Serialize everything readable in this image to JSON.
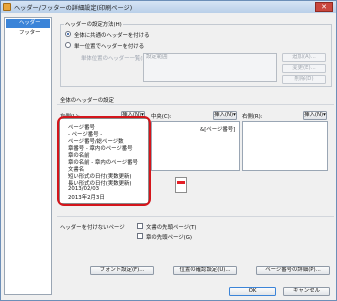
{
  "window": {
    "title": "ヘッダー/フッターの詳細設定(印刷ページ)",
    "close_glyph": "✕"
  },
  "nav": {
    "items": [
      {
        "label": "ヘッダー",
        "selected": true
      },
      {
        "label": "フッター",
        "selected": false
      }
    ]
  },
  "settings_group": {
    "title": "ヘッダーの設定方法(H)",
    "option_common": "全体に共通のヘッダーを付ける",
    "option_per_unit": "単一位置でヘッダーを付ける",
    "unit_list_label": "単体位置のヘッダー一覧(I):",
    "unit_list_value": "設定範囲",
    "buttons": [
      "追加(A)...",
      "変更(E)...",
      "削除(D)"
    ]
  },
  "common_header": {
    "section_title": "全体のヘッダーの設定",
    "left_label": "左側(L):",
    "center_label": "中央(C):",
    "right_label": "右側(R):",
    "insert_button": "挿入(N)▾",
    "center_value": "&[ページ番号]"
  },
  "insert_menu": {
    "items": [
      "ページ番号",
      "- ページ番号 -",
      "ページ番号/総ページ数",
      "章番号 - 章内のページ番号",
      "章の名前",
      "章の名前 - 章内のページ番号",
      "文書名",
      "短い形式の日付(実数更新)",
      "長い形式の日付(実数更新)",
      "2013/02/03",
      "2013年2月3日"
    ]
  },
  "hide_header": {
    "label": "ヘッダーを付けないページ",
    "option_first_doc": "文書の先頭ページ(T)",
    "option_first_chapter": "章の先頭ページ(G)"
  },
  "footer_buttons": {
    "font": "フォント設定(F)...",
    "position": "位置の確認設定(U)...",
    "page_detail": "ページ番号の詳細(P)..."
  },
  "dialog_buttons": {
    "ok": "OK",
    "cancel": "キャンセル"
  },
  "colors": {
    "highlight": "#d4151b",
    "selection": "#3b84d8",
    "preview_mark": "#e41e26"
  }
}
